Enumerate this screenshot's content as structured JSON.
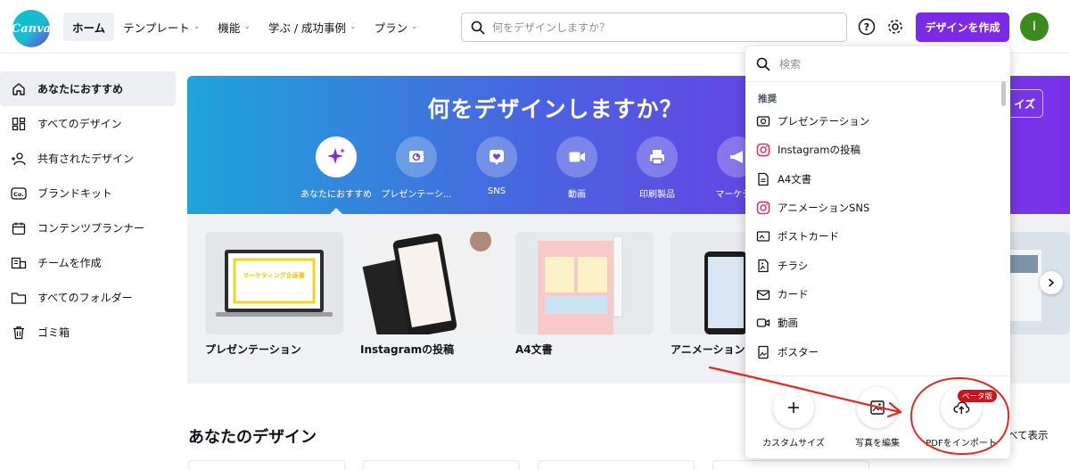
{
  "brand": {
    "logo_text": "Canva",
    "accent": "#7d2ae8"
  },
  "nav": {
    "items": [
      {
        "label": "ホーム",
        "active": true,
        "dropdown": false
      },
      {
        "label": "テンプレート",
        "active": false,
        "dropdown": true
      },
      {
        "label": "機能",
        "active": false,
        "dropdown": true
      },
      {
        "label": "学ぶ / 成功事例",
        "active": false,
        "dropdown": true
      },
      {
        "label": "プラン",
        "active": false,
        "dropdown": true
      }
    ]
  },
  "search": {
    "placeholder": "何をデザインしますか？"
  },
  "header": {
    "create_label": "デザインを作成",
    "avatar_initial": "I",
    "help_icon": "help-icon",
    "settings_icon": "gear-icon"
  },
  "sidebar": {
    "items": [
      {
        "label": "あなたにおすすめ",
        "icon": "home-icon",
        "active": true
      },
      {
        "label": "すべてのデザイン",
        "icon": "grid-icon",
        "active": false
      },
      {
        "label": "共有されたデザイン",
        "icon": "shared-users-icon",
        "active": false
      },
      {
        "label": "ブランドキット",
        "icon": "brand-kit-icon",
        "active": false
      },
      {
        "label": "コンテンツプランナー",
        "icon": "calendar-icon",
        "active": false
      },
      {
        "label": "チームを作成",
        "icon": "team-icon",
        "active": false
      },
      {
        "label": "すべてのフォルダー",
        "icon": "folder-icon",
        "active": false
      },
      {
        "label": "ゴミ箱",
        "icon": "trash-icon",
        "active": false
      }
    ]
  },
  "hero": {
    "title": "何をデザインしますか？",
    "categories": [
      {
        "label": "あなたにおすすめ",
        "icon": "sparkle-icon",
        "active": true
      },
      {
        "label": "プレゼンテーシ...",
        "icon": "presentation-icon",
        "active": false
      },
      {
        "label": "SNS",
        "icon": "heart-icon",
        "active": false
      },
      {
        "label": "動画",
        "icon": "video-icon",
        "active": false
      },
      {
        "label": "印刷製品",
        "icon": "printer-icon",
        "active": false
      },
      {
        "label": "マーケティ",
        "icon": "megaphone-icon",
        "active": false
      }
    ],
    "partial_button": "イズ"
  },
  "templates": {
    "items": [
      {
        "label": "プレゼンテーション",
        "thumb_title": "マーケティング企画書"
      },
      {
        "label": "Instagramの投稿"
      },
      {
        "label": "A4文書"
      },
      {
        "label": "アニメーションS"
      },
      {
        "label": ""
      },
      {
        "label": ""
      }
    ]
  },
  "designs": {
    "title": "あなたのデザイン",
    "see_all": "べて表示"
  },
  "dropdown": {
    "search_placeholder": "検索",
    "section_label": "推奨",
    "items": [
      {
        "label": "プレゼンテーション",
        "icon": "presentation-icon"
      },
      {
        "label": "Instagramの投稿",
        "icon": "instagram-icon"
      },
      {
        "label": "A4文書",
        "icon": "document-icon"
      },
      {
        "label": "アニメーションSNS",
        "icon": "instagram-icon"
      },
      {
        "label": "ポストカード",
        "icon": "postcard-icon"
      },
      {
        "label": "チラシ",
        "icon": "flyer-icon"
      },
      {
        "label": "カード",
        "icon": "envelope-icon"
      },
      {
        "label": "動画",
        "icon": "video-icon"
      },
      {
        "label": "ポスター",
        "icon": "poster-icon"
      }
    ],
    "actions": [
      {
        "label": "カスタムサイズ",
        "icon": "plus-icon"
      },
      {
        "label": "写真を編集",
        "icon": "image-edit-icon"
      },
      {
        "label": "PDFをインポート",
        "icon": "upload-cloud-icon"
      }
    ],
    "beta_label": "ベータ版",
    "annotation_color": "#e8281e"
  }
}
